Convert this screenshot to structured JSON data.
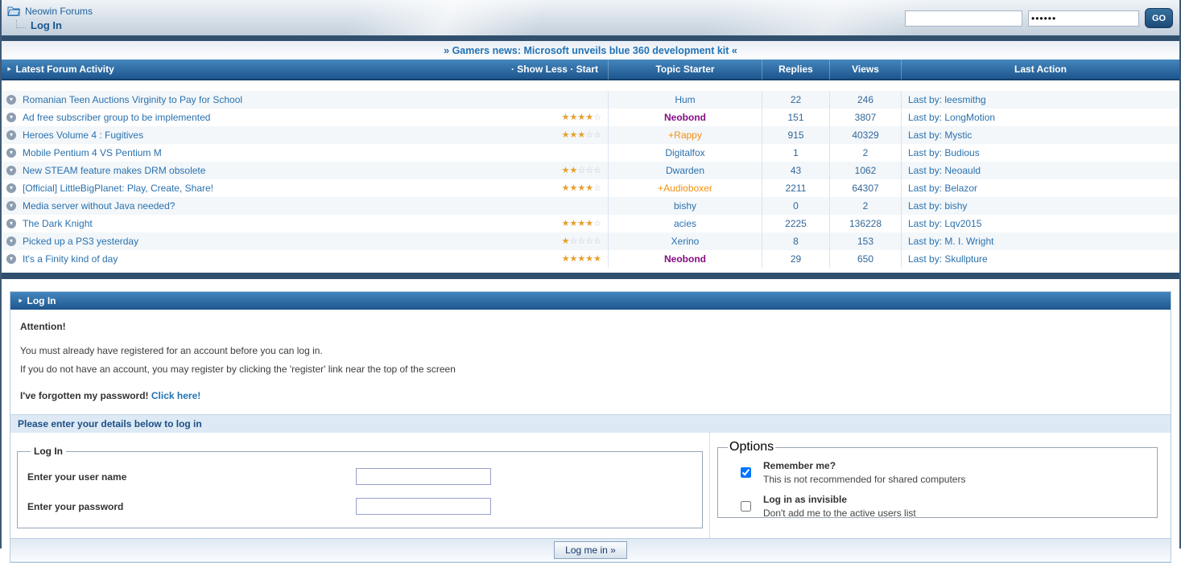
{
  "icons": {
    "header_arrow": "‣",
    "star_filled": "★",
    "star_empty": "☆"
  },
  "breadcrumb": {
    "forum": "Neowin Forums",
    "current": "Log In"
  },
  "top_right": {
    "username_value": "",
    "password_value": "••••••",
    "go_label": "GO"
  },
  "news": "» Gamers news: Microsoft unveils blue 360 development kit «",
  "table": {
    "title": "Latest Forum Activity",
    "controls": "· Show Less · Start",
    "columns": [
      "Topic Starter",
      "Replies",
      "Views",
      "Last Action"
    ],
    "rows": [
      {
        "title": "Romanian Teen Auctions Virginity to Pay for School",
        "stars": 0,
        "starter": "Hum",
        "starter_style": "name-normal",
        "replies": "22",
        "views": "246",
        "last": "Last by: leesmithg"
      },
      {
        "title": "Ad free subscriber group to be implemented",
        "stars": 4,
        "starter": "Neobond",
        "starter_style": "name-purple",
        "replies": "151",
        "views": "3807",
        "last": "Last by: LongMotion"
      },
      {
        "title": "Heroes Volume 4 : Fugitives",
        "stars": 3,
        "starter": "+Rappy",
        "starter_style": "name-orange",
        "replies": "915",
        "views": "40329",
        "last": "Last by: Mystic"
      },
      {
        "title": "Mobile Pentium 4 VS Pentium M",
        "stars": 0,
        "starter": "Digitalfox",
        "starter_style": "name-normal",
        "replies": "1",
        "views": "2",
        "last": "Last by: Budious"
      },
      {
        "title": "New STEAM feature makes DRM obsolete",
        "stars": 2,
        "starter": "Dwarden",
        "starter_style": "name-normal",
        "replies": "43",
        "views": "1062",
        "last": "Last by: Neoauld"
      },
      {
        "title": "[Official] LittleBigPlanet: Play, Create, Share!",
        "stars": 4,
        "starter": "+Audioboxer",
        "starter_style": "name-orange",
        "replies": "2211",
        "views": "64307",
        "last": "Last by: Belazor"
      },
      {
        "title": "Media server without Java needed?",
        "stars": 0,
        "starter": "bishy",
        "starter_style": "name-normal",
        "replies": "0",
        "views": "2",
        "last": "Last by: bishy"
      },
      {
        "title": "The Dark Knight",
        "stars": 4,
        "starter": "acies",
        "starter_style": "name-normal",
        "replies": "2225",
        "views": "136228",
        "last": "Last by: Lqv2015"
      },
      {
        "title": "Picked up a PS3 yesterday",
        "stars": 1,
        "starter": "Xerino",
        "starter_style": "name-normal",
        "replies": "8",
        "views": "153",
        "last": "Last by: M. I. Wright"
      },
      {
        "title": "It's a Finity kind of day",
        "stars": 5,
        "starter": "Neobond",
        "starter_style": "name-purple",
        "replies": "29",
        "views": "650",
        "last": "Last by: Skullpture"
      }
    ]
  },
  "login": {
    "header": "Log In",
    "attention_title": "Attention!",
    "line1": "You must already have registered for an account before you can log in.",
    "line2": "If you do not have an account, you may register by clicking the 'register' link near the top of the screen",
    "forgot_bold": "I've forgotten my password!",
    "forgot_link": "Click here!",
    "details_bar": "Please enter your details below to log in",
    "fieldset_login": {
      "legend": "Log In",
      "username_label": "Enter your user name",
      "password_label": "Enter your password"
    },
    "fieldset_options": {
      "legend": "Options",
      "remember_label": "Remember me?",
      "remember_note": "This is not recommended for shared computers",
      "remember_checked": true,
      "invisible_label": "Log in as invisible",
      "invisible_note": "Don't add me to the active users list",
      "invisible_checked": false
    },
    "submit_label": "Log me in »"
  },
  "colors": {
    "header_gradient_top": "#4486bd",
    "header_gradient_bottom": "#1e568e",
    "dark_bar": "#31506e",
    "link_blue": "#2a71ad",
    "name_purple": "#840d84",
    "name_orange": "#f29113",
    "star_gold": "#e5a02c"
  }
}
